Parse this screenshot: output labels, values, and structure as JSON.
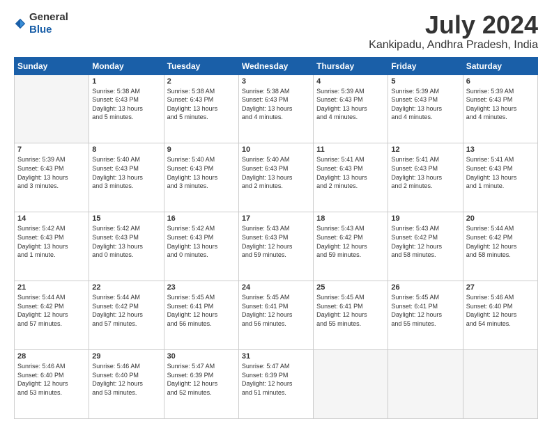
{
  "header": {
    "logo_line1": "General",
    "logo_line2": "Blue",
    "title": "July 2024",
    "subtitle": "Kankipadu, Andhra Pradesh, India"
  },
  "days_of_week": [
    "Sunday",
    "Monday",
    "Tuesday",
    "Wednesday",
    "Thursday",
    "Friday",
    "Saturday"
  ],
  "weeks": [
    [
      {
        "day": "",
        "info": ""
      },
      {
        "day": "1",
        "info": "Sunrise: 5:38 AM\nSunset: 6:43 PM\nDaylight: 13 hours\nand 5 minutes."
      },
      {
        "day": "2",
        "info": "Sunrise: 5:38 AM\nSunset: 6:43 PM\nDaylight: 13 hours\nand 5 minutes."
      },
      {
        "day": "3",
        "info": "Sunrise: 5:38 AM\nSunset: 6:43 PM\nDaylight: 13 hours\nand 4 minutes."
      },
      {
        "day": "4",
        "info": "Sunrise: 5:39 AM\nSunset: 6:43 PM\nDaylight: 13 hours\nand 4 minutes."
      },
      {
        "day": "5",
        "info": "Sunrise: 5:39 AM\nSunset: 6:43 PM\nDaylight: 13 hours\nand 4 minutes."
      },
      {
        "day": "6",
        "info": "Sunrise: 5:39 AM\nSunset: 6:43 PM\nDaylight: 13 hours\nand 4 minutes."
      }
    ],
    [
      {
        "day": "7",
        "info": "Sunrise: 5:39 AM\nSunset: 6:43 PM\nDaylight: 13 hours\nand 3 minutes."
      },
      {
        "day": "8",
        "info": "Sunrise: 5:40 AM\nSunset: 6:43 PM\nDaylight: 13 hours\nand 3 minutes."
      },
      {
        "day": "9",
        "info": "Sunrise: 5:40 AM\nSunset: 6:43 PM\nDaylight: 13 hours\nand 3 minutes."
      },
      {
        "day": "10",
        "info": "Sunrise: 5:40 AM\nSunset: 6:43 PM\nDaylight: 13 hours\nand 2 minutes."
      },
      {
        "day": "11",
        "info": "Sunrise: 5:41 AM\nSunset: 6:43 PM\nDaylight: 13 hours\nand 2 minutes."
      },
      {
        "day": "12",
        "info": "Sunrise: 5:41 AM\nSunset: 6:43 PM\nDaylight: 13 hours\nand 2 minutes."
      },
      {
        "day": "13",
        "info": "Sunrise: 5:41 AM\nSunset: 6:43 PM\nDaylight: 13 hours\nand 1 minute."
      }
    ],
    [
      {
        "day": "14",
        "info": "Sunrise: 5:42 AM\nSunset: 6:43 PM\nDaylight: 13 hours\nand 1 minute."
      },
      {
        "day": "15",
        "info": "Sunrise: 5:42 AM\nSunset: 6:43 PM\nDaylight: 13 hours\nand 0 minutes."
      },
      {
        "day": "16",
        "info": "Sunrise: 5:42 AM\nSunset: 6:43 PM\nDaylight: 13 hours\nand 0 minutes."
      },
      {
        "day": "17",
        "info": "Sunrise: 5:43 AM\nSunset: 6:43 PM\nDaylight: 12 hours\nand 59 minutes."
      },
      {
        "day": "18",
        "info": "Sunrise: 5:43 AM\nSunset: 6:42 PM\nDaylight: 12 hours\nand 59 minutes."
      },
      {
        "day": "19",
        "info": "Sunrise: 5:43 AM\nSunset: 6:42 PM\nDaylight: 12 hours\nand 58 minutes."
      },
      {
        "day": "20",
        "info": "Sunrise: 5:44 AM\nSunset: 6:42 PM\nDaylight: 12 hours\nand 58 minutes."
      }
    ],
    [
      {
        "day": "21",
        "info": "Sunrise: 5:44 AM\nSunset: 6:42 PM\nDaylight: 12 hours\nand 57 minutes."
      },
      {
        "day": "22",
        "info": "Sunrise: 5:44 AM\nSunset: 6:42 PM\nDaylight: 12 hours\nand 57 minutes."
      },
      {
        "day": "23",
        "info": "Sunrise: 5:45 AM\nSunset: 6:41 PM\nDaylight: 12 hours\nand 56 minutes."
      },
      {
        "day": "24",
        "info": "Sunrise: 5:45 AM\nSunset: 6:41 PM\nDaylight: 12 hours\nand 56 minutes."
      },
      {
        "day": "25",
        "info": "Sunrise: 5:45 AM\nSunset: 6:41 PM\nDaylight: 12 hours\nand 55 minutes."
      },
      {
        "day": "26",
        "info": "Sunrise: 5:45 AM\nSunset: 6:41 PM\nDaylight: 12 hours\nand 55 minutes."
      },
      {
        "day": "27",
        "info": "Sunrise: 5:46 AM\nSunset: 6:40 PM\nDaylight: 12 hours\nand 54 minutes."
      }
    ],
    [
      {
        "day": "28",
        "info": "Sunrise: 5:46 AM\nSunset: 6:40 PM\nDaylight: 12 hours\nand 53 minutes."
      },
      {
        "day": "29",
        "info": "Sunrise: 5:46 AM\nSunset: 6:40 PM\nDaylight: 12 hours\nand 53 minutes."
      },
      {
        "day": "30",
        "info": "Sunrise: 5:47 AM\nSunset: 6:39 PM\nDaylight: 12 hours\nand 52 minutes."
      },
      {
        "day": "31",
        "info": "Sunrise: 5:47 AM\nSunset: 6:39 PM\nDaylight: 12 hours\nand 51 minutes."
      },
      {
        "day": "",
        "info": ""
      },
      {
        "day": "",
        "info": ""
      },
      {
        "day": "",
        "info": ""
      }
    ]
  ]
}
